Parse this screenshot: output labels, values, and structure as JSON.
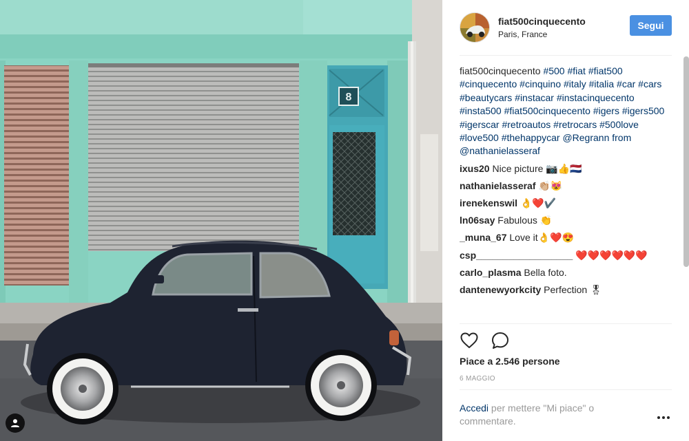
{
  "post": {
    "username": "fiat500cinquecento",
    "location": "Paris, France",
    "follow_label": "Segui",
    "house_number": "8",
    "caption_user": "fiat500cinquecento",
    "caption_text": "#500 #fiat #fiat500 #cinquecento #cinquino #italy #italia #car #cars #beautycars #instacar #instacinquecento #insta500 #fiat500cinquecento #igers #igers500 #igerscar #retroautos #retrocars #500love #love500 #thehappycar @Regrann from @nathanielasseraf",
    "comments": [
      {
        "user": "ixus20",
        "text": "Nice picture 📷👍🇳🇱"
      },
      {
        "user": "nathanielasseraf",
        "text": "👏🏼😻"
      },
      {
        "user": "irenekenswil",
        "text": "👌❤️✔️"
      },
      {
        "user": "ln06say",
        "text": "Fabulous 👏"
      },
      {
        "user": "_muna_67",
        "text": "Love it👌❤️😍"
      },
      {
        "user": "csp__________________",
        "text": "❤️❤️❤️❤️❤️❤️"
      },
      {
        "user": "carlo_plasma",
        "text": "Bella foto."
      },
      {
        "user": "dantenewyorkcity",
        "text": "Perfection 🎖"
      }
    ],
    "likes_text": "Piace a 2.546 persone",
    "date": "6 MAGGIO",
    "login_link": "Accedi",
    "login_rest": " per mettere \"Mi piace\" o commentare.",
    "icons": {
      "like": "heart-icon",
      "comment": "comment-bubble-icon",
      "more": "more-options-icon",
      "user_tag": "person-tag-icon"
    },
    "colors": {
      "follow_button": "#4a90e2",
      "link": "#003569",
      "car_body": "#1d2230",
      "wall": "#8fd6c5"
    }
  }
}
